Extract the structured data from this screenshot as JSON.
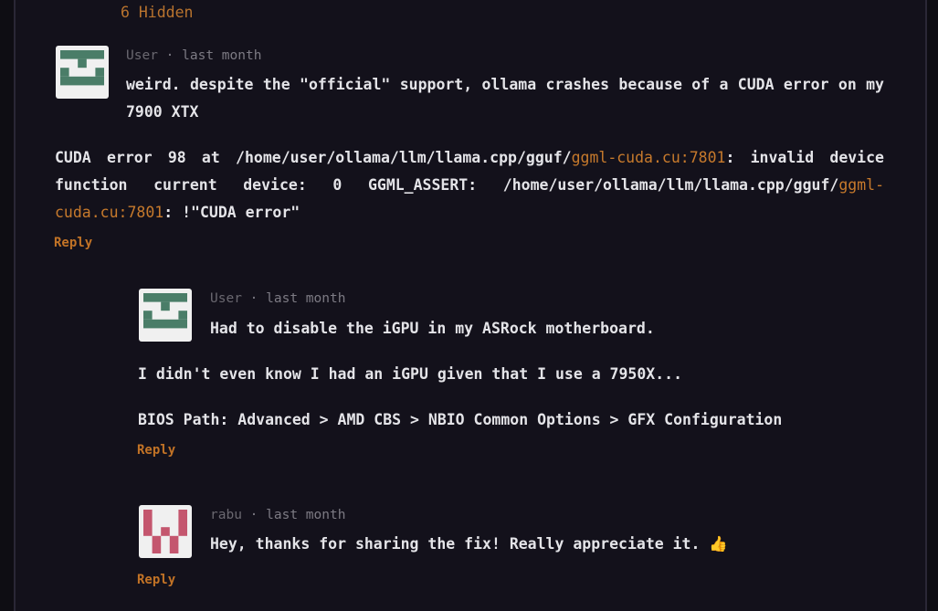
{
  "hidden_label": "6 Hidden",
  "comments": [
    {
      "author": "User",
      "time": "last month",
      "line1": "weird. despite the \"official\" support, ollama crashes because of a CUDA error on my 7900 XTX",
      "err_a": "CUDA error 98 at /home/user/ollama/llm/llama.cpp/gguf/",
      "err_link1": "ggml-cuda.cu:7801",
      "err_b": ": invalid device function current device: 0 GGML_ASSERT: /home/user/ollama/llm/llama.cpp/gguf/",
      "err_link2": "ggml-cuda.cu:7801",
      "err_c": ": !\"CUDA error\"",
      "reply": "Reply",
      "avatar_color": "#4a7d68"
    },
    {
      "author": "User",
      "time": "last month",
      "line1": "Had to disable the iGPU in my ASRock motherboard.",
      "line2": "I didn't even know I had an iGPU given that I use a 7950X...",
      "line3": "BIOS Path: Advanced > AMD CBS > NBIO Common Options > GFX Configuration",
      "reply": "Reply",
      "avatar_color": "#4a7d68"
    },
    {
      "author": "rabu",
      "time": "last month",
      "line1": "Hey, thanks for sharing the fix! Really appreciate it. 👍",
      "reply": "Reply",
      "avatar_color": "#c4566e"
    }
  ],
  "separator": "·"
}
